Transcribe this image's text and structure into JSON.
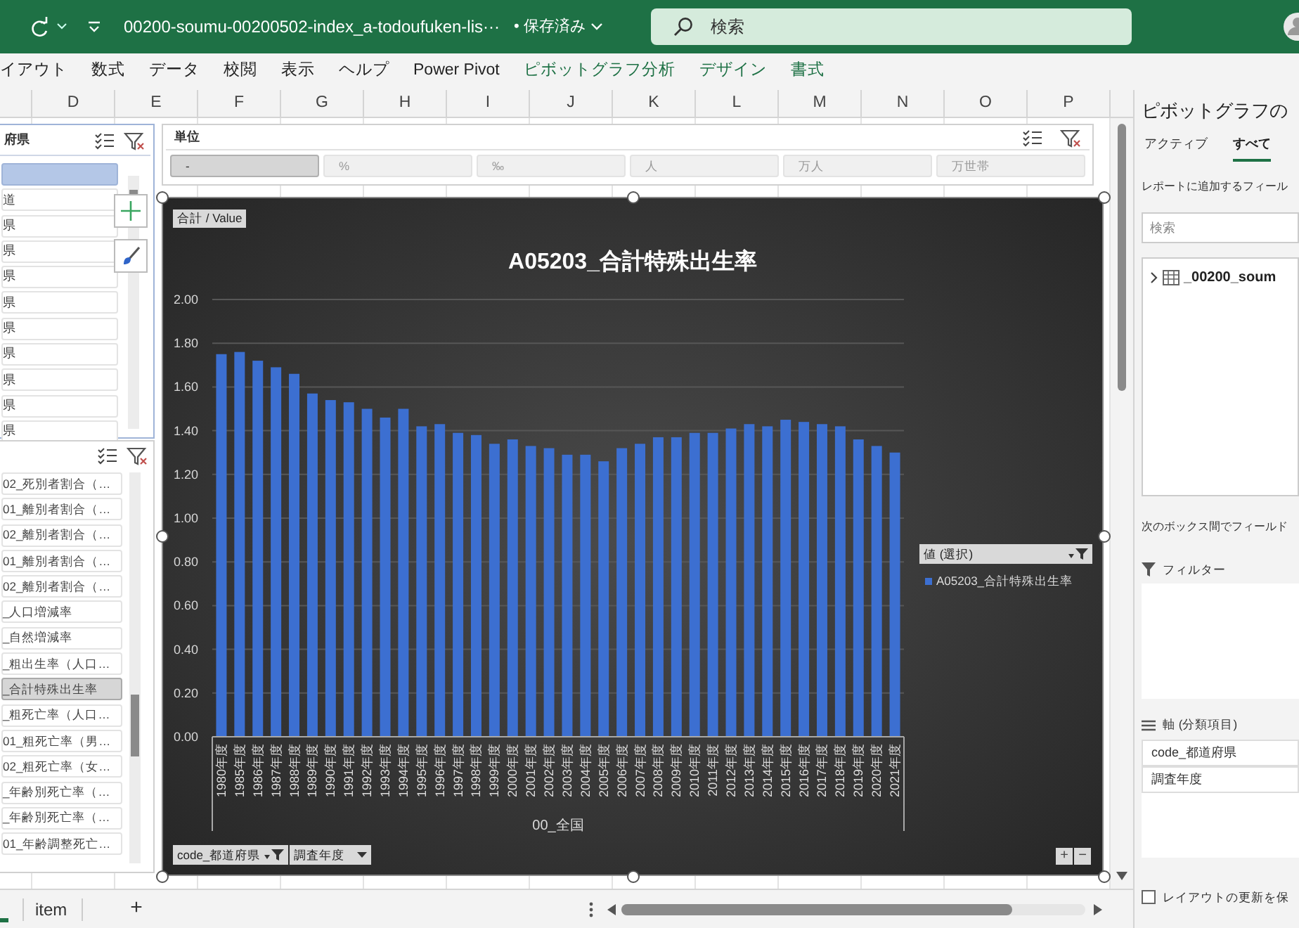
{
  "title_bar": {
    "title": "00200-soumu-00200502-index_a-todoufuken-lis···",
    "save_status": "• 保存済み",
    "search_placeholder": "検索"
  },
  "ribbon_tabs": [
    {
      "label": "イアウト",
      "kind": "normal"
    },
    {
      "label": "数式",
      "kind": "normal"
    },
    {
      "label": "データ",
      "kind": "normal"
    },
    {
      "label": "校閲",
      "kind": "normal"
    },
    {
      "label": "表示",
      "kind": "normal"
    },
    {
      "label": "ヘルプ",
      "kind": "normal"
    },
    {
      "label": "Power Pivot",
      "kind": "normal"
    },
    {
      "label": "ピボットグラフ分析",
      "kind": "contextual"
    },
    {
      "label": "デザイン",
      "kind": "contextual"
    },
    {
      "label": "書式",
      "kind": "contextual"
    }
  ],
  "column_headers": [
    "D",
    "E",
    "F",
    "G",
    "H",
    "I",
    "J",
    "K",
    "L",
    "M",
    "N",
    "O",
    "P"
  ],
  "slicer_prefecture": {
    "title": "府県",
    "items": [
      {
        "selected": true
      },
      {
        "label": "道",
        "selected": false
      },
      {
        "label": "県",
        "selected": false
      },
      {
        "label": "県",
        "selected": false
      },
      {
        "label": "県",
        "selected": false
      },
      {
        "label": "県",
        "selected": false
      },
      {
        "label": "県",
        "selected": false
      },
      {
        "label": "県",
        "selected": false
      },
      {
        "label": "県",
        "selected": false
      },
      {
        "label": "県",
        "selected": false
      },
      {
        "label": "県",
        "selected": false
      }
    ]
  },
  "slicer_indicator": {
    "items": [
      {
        "label": "02_死別者割合（…",
        "selected": false
      },
      {
        "label": "01_離別者割合（…",
        "selected": false
      },
      {
        "label": "02_離別者割合（…",
        "selected": false
      },
      {
        "label": "01_離別者割合（…",
        "selected": false
      },
      {
        "label": "02_離別者割合（…",
        "selected": false
      },
      {
        "label": "_人口増減率",
        "selected": false
      },
      {
        "label": "_自然増減率",
        "selected": false
      },
      {
        "label": "_粗出生率（人口…",
        "selected": false
      },
      {
        "label": "_合計特殊出生率",
        "selected": true
      },
      {
        "label": "_粗死亡率（人口…",
        "selected": false
      },
      {
        "label": "01_粗死亡率（男…",
        "selected": false
      },
      {
        "label": "02_粗死亡率（女…",
        "selected": false
      },
      {
        "label": "_年齢別死亡率（…",
        "selected": false
      },
      {
        "label": "_年齢別死亡率（…",
        "selected": false
      },
      {
        "label": "01_年齢調整死亡…",
        "selected": false
      }
    ]
  },
  "slicer_unit": {
    "title": "単位",
    "items": [
      {
        "label": "-",
        "selected": true
      },
      {
        "label": "%",
        "selected": false
      },
      {
        "label": "‰",
        "selected": false
      },
      {
        "label": "人",
        "selected": false
      },
      {
        "label": "万人",
        "selected": false
      },
      {
        "label": "万世帯",
        "selected": false
      }
    ]
  },
  "chart": {
    "value_button": "合計 / Value",
    "legend_title": "値 (選択)",
    "axis_buttons": [
      "code_都道府県",
      "調査年度"
    ],
    "zoom_buttons": [
      "+",
      "−"
    ],
    "chart_data": {
      "type": "bar",
      "grid": true,
      "title": "A05203_合計特殊出生率",
      "xlabel": "00_全国",
      "categories": [
        "1980年度",
        "1985年度",
        "1986年度",
        "1987年度",
        "1988年度",
        "1989年度",
        "1990年度",
        "1991年度",
        "1992年度",
        "1993年度",
        "1994年度",
        "1995年度",
        "1996年度",
        "1997年度",
        "1998年度",
        "1999年度",
        "2000年度",
        "2001年度",
        "2002年度",
        "2003年度",
        "2004年度",
        "2005年度",
        "2006年度",
        "2007年度",
        "2008年度",
        "2009年度",
        "2010年度",
        "2011年度",
        "2012年度",
        "2013年度",
        "2014年度",
        "2015年度",
        "2016年度",
        "2017年度",
        "2018年度",
        "2019年度",
        "2020年度",
        "2021年度"
      ],
      "series": [
        {
          "name": "A05203_合計特殊出生率",
          "color": "#3c6fd1",
          "values": [
            1.75,
            1.76,
            1.72,
            1.69,
            1.66,
            1.57,
            1.54,
            1.53,
            1.5,
            1.46,
            1.5,
            1.42,
            1.43,
            1.39,
            1.38,
            1.34,
            1.36,
            1.33,
            1.32,
            1.29,
            1.29,
            1.26,
            1.32,
            1.34,
            1.37,
            1.37,
            1.39,
            1.39,
            1.41,
            1.43,
            1.42,
            1.45,
            1.44,
            1.43,
            1.42,
            1.36,
            1.33,
            1.3
          ]
        }
      ],
      "ylim": [
        0,
        2
      ],
      "yticks": [
        {
          "value": 0,
          "label": "0.00"
        },
        {
          "value": 0.2,
          "label": "0.20"
        },
        {
          "value": 0.4,
          "label": "0.40"
        },
        {
          "value": 0.6,
          "label": "0.60"
        },
        {
          "value": 0.8,
          "label": "0.80"
        },
        {
          "value": 1,
          "label": "1.00"
        },
        {
          "value": 1.2,
          "label": "1.20"
        },
        {
          "value": 1.4,
          "label": "1.40"
        },
        {
          "value": 1.6,
          "label": "1.60"
        },
        {
          "value": 1.8,
          "label": "1.80"
        },
        {
          "value": 2,
          "label": "2.00"
        }
      ]
    }
  },
  "field_pane": {
    "title": "ピボットグラフの",
    "tabs": [
      {
        "label": "アクティブ",
        "selected": false
      },
      {
        "label": "すべて",
        "selected": true
      }
    ],
    "add_hint": "レポートに追加するフィール",
    "search_placeholder": "検索",
    "tables": [
      {
        "label": "_00200_soum",
        "expanded": false
      }
    ],
    "areas_hint": "次のボックス間でフィールド",
    "filter_label": "フィルター",
    "axis_label": "軸 (分類項目)",
    "axis_fields": [
      "code_都道府県",
      "調査年度"
    ],
    "defer_label": "レイアウトの更新を保",
    "defer_checked": false
  },
  "sheet_tabs": [
    "item",
    "+"
  ]
}
